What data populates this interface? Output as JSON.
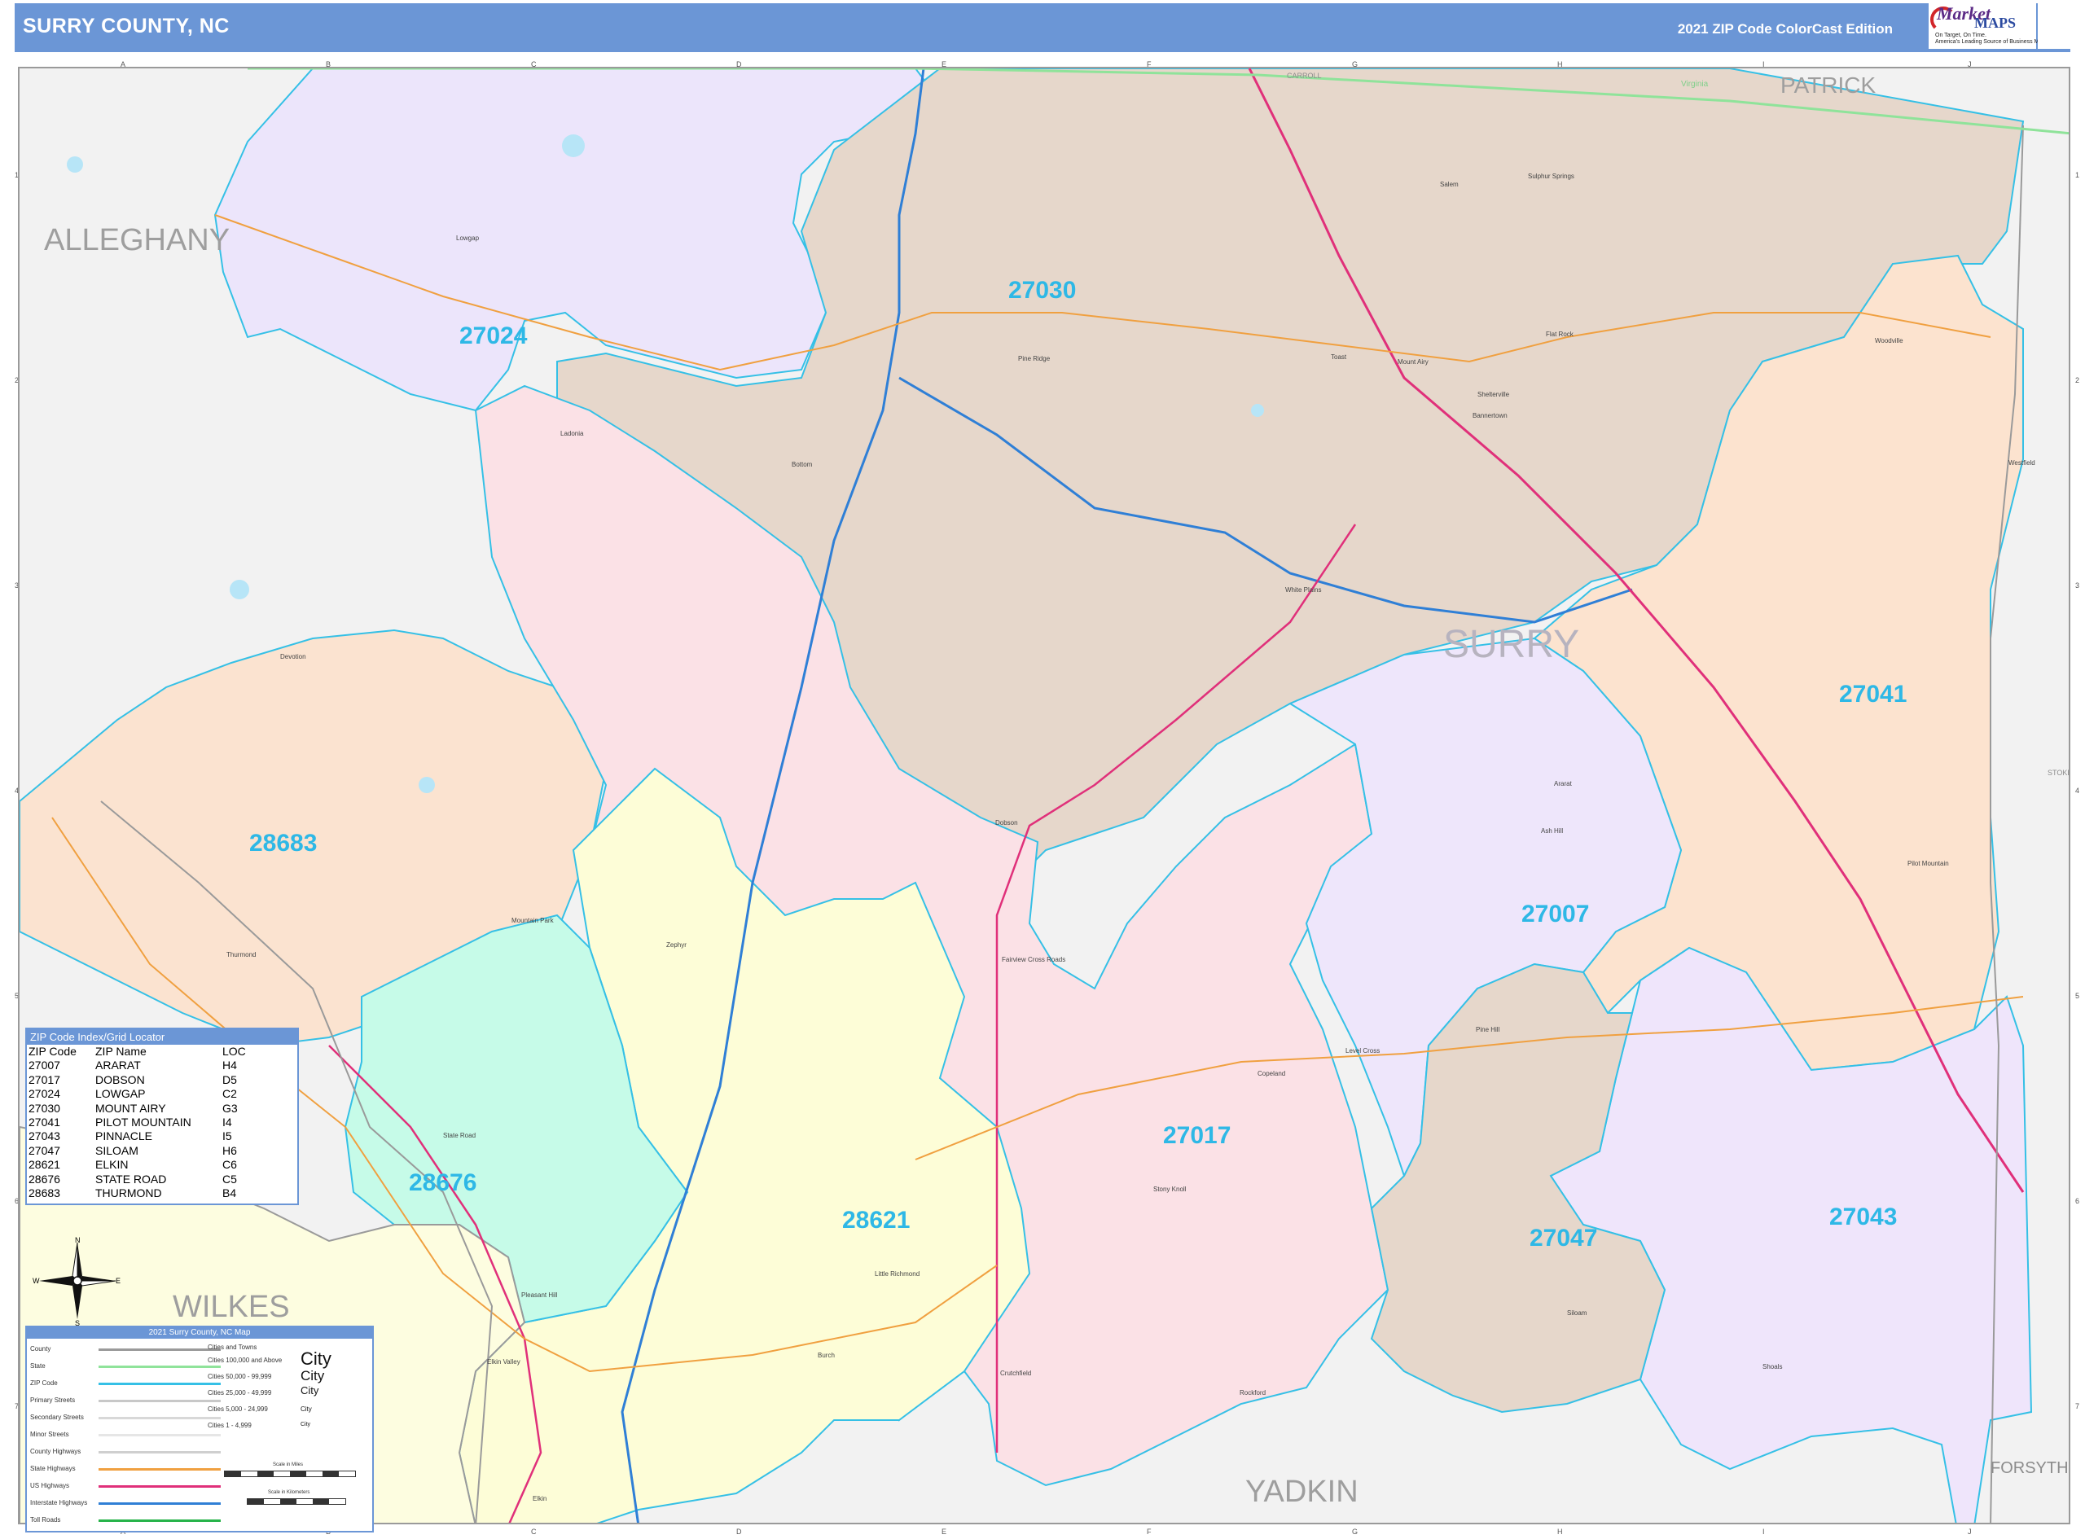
{
  "header": {
    "title": "SURRY COUNTY, NC",
    "edition": "2021 ZIP Code ColorCast Edition"
  },
  "logo": {
    "word1": "Market",
    "word2": "MAPS",
    "tagline": "On Target, On Time.",
    "tagline2": "America's Leading Source of Business Maps"
  },
  "grid": {
    "columns": [
      "A",
      "B",
      "C",
      "D",
      "E",
      "F",
      "G",
      "H",
      "I",
      "J"
    ],
    "rows": [
      "1",
      "2",
      "3",
      "4",
      "5",
      "6",
      "7"
    ]
  },
  "counties": {
    "alleghany": "ALLEGHANY",
    "wilkes": "WILKES",
    "yadkin": "YADKIN",
    "patrick": "PATRICK",
    "forsyth": "FORSYTH",
    "carroll": "CARROLL",
    "virginia": "Virginia",
    "stokes": "STOKES",
    "surry": "SURRY"
  },
  "zip_labels": [
    "27024",
    "27030",
    "28683",
    "27041",
    "27007",
    "27017",
    "28676",
    "28621",
    "27047",
    "27043"
  ],
  "places": {
    "lowgap": "Lowgap",
    "ladonia": "Ladonia",
    "bottom": "Bottom",
    "pine_ridge": "Pine Ridge",
    "toast": "Toast",
    "mount_airy": "Mount Airy",
    "salem": "Salem",
    "sulphur_springs": "Sulphur Springs",
    "flat_rock": "Flat Rock",
    "woodville": "Woodville",
    "shelter": "Shelterville",
    "bannertown": "Bannertown",
    "white_plains": "White Plains",
    "dobson": "Dobson",
    "devotion": "Devotion",
    "thurmond": "Thurmond",
    "mountain_park": "Mountain Park",
    "zephyr": "Zephyr",
    "fairview": "Fairview Cross Roads",
    "ararat": "Ararat",
    "ash_hill": "Ash Hill",
    "pilot_mountain": "Pilot Mountain",
    "pine_hill": "Pine Hill",
    "level_cross": "Level Cross",
    "copeland": "Copeland",
    "state_road": "State Road",
    "stony_knoll": "Stony Knoll",
    "little_richmond": "Little Richmond",
    "siloam": "Siloam",
    "shoals": "Shoals",
    "rockford": "Rockford",
    "crutchfield": "Crutchfield",
    "burch": "Burch",
    "elkin": "Elkin",
    "elkin_valley": "Elkin Valley",
    "pleasant_hill": "Pleasant Hill",
    "westfield": "Westfield"
  },
  "index": {
    "title": "ZIP Code Index/Grid Locator",
    "headers": [
      "ZIP Code",
      "ZIP Name",
      "LOC"
    ],
    "rows": [
      [
        "27007",
        "ARARAT",
        "H4"
      ],
      [
        "27017",
        "DOBSON",
        "D5"
      ],
      [
        "27024",
        "LOWGAP",
        "C2"
      ],
      [
        "27030",
        "MOUNT AIRY",
        "G3"
      ],
      [
        "27041",
        "PILOT MOUNTAIN",
        "I4"
      ],
      [
        "27043",
        "PINNACLE",
        "I5"
      ],
      [
        "27047",
        "SILOAM",
        "H6"
      ],
      [
        "28621",
        "ELKIN",
        "C6"
      ],
      [
        "28676",
        "STATE ROAD",
        "C5"
      ],
      [
        "28683",
        "THURMOND",
        "B4"
      ]
    ]
  },
  "compass": {
    "n": "N",
    "s": "S",
    "e": "E",
    "w": "W"
  },
  "legend": {
    "title": "2021 Surry County, NC Map",
    "items": [
      {
        "label": "County",
        "color": "#9a9a9a"
      },
      {
        "label": "State",
        "color": "#8fe39a"
      },
      {
        "label": "ZIP Code",
        "color": "#35c0e6"
      },
      {
        "label": "Primary Streets",
        "color": "#c8c8c8"
      },
      {
        "label": "Secondary Streets",
        "color": "#d8d8d8"
      },
      {
        "label": "Minor Streets",
        "color": "#e6e6e6"
      },
      {
        "label": "County Highways",
        "color": "#cfcfcf"
      },
      {
        "label": "State Highways",
        "color": "#f0a040"
      },
      {
        "label": "US Highways",
        "color": "#e0307a"
      },
      {
        "label": "Interstate Highways",
        "color": "#2f7fd6"
      },
      {
        "label": "Toll Roads",
        "color": "#27b34a"
      }
    ],
    "cities_title": "Cities and Towns",
    "city_classes": [
      {
        "label": "Cities 100,000 and Above",
        "sample": "City"
      },
      {
        "label": "Cities 50,000 - 99,999",
        "sample": "City"
      },
      {
        "label": "Cities 25,000 - 49,999",
        "sample": "City"
      },
      {
        "label": "Cities 5,000 - 24,999",
        "sample": "City"
      },
      {
        "label": "Cities 1 - 4,999",
        "sample": "City"
      }
    ],
    "scale_miles": "Scale in Miles",
    "scale_km": "Scale in Kilometers"
  },
  "colors": {
    "header": "#6b96d6",
    "zip_label": "#2eb8e6",
    "zip_border": "#35c0e6",
    "z27024": "#ece5fb",
    "z27030": "#e6d7cb",
    "z28683": "#fbe3d0",
    "z27017": "#fbe1e6",
    "z27041": "#fce3cf",
    "z27007": "#eee6fb",
    "z28676": "#c6fbe8",
    "z28621": "#fdfdd7",
    "z27047": "#e6d7cb",
    "z27043": "#efe5fb",
    "outside": "#f2f2f2"
  }
}
